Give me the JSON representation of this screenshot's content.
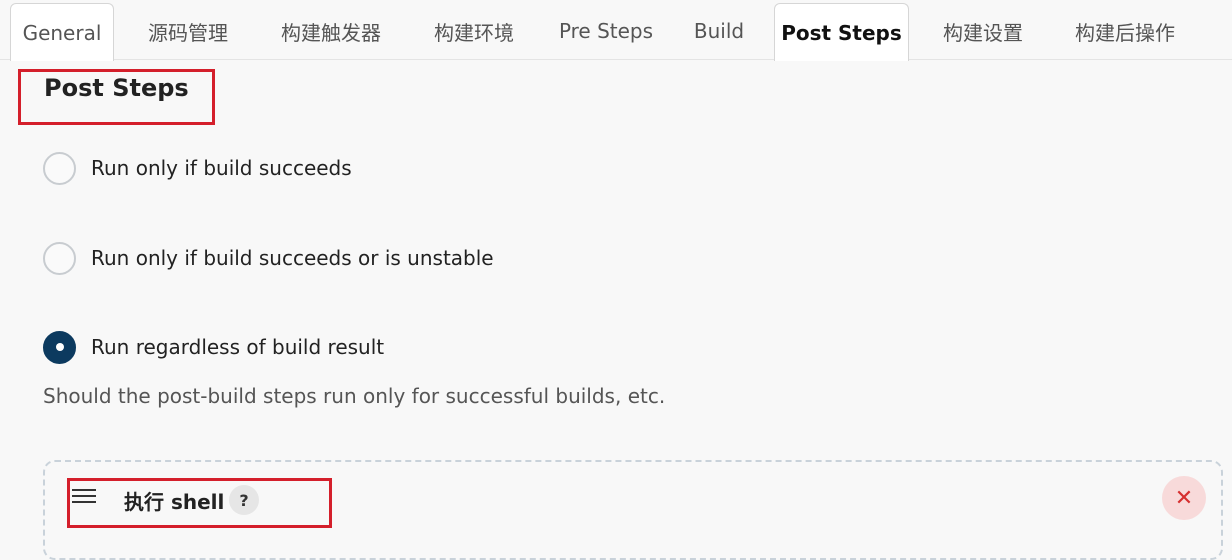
{
  "tabs": [
    {
      "label": "General"
    },
    {
      "label": "源码管理"
    },
    {
      "label": "构建触发器"
    },
    {
      "label": "构建环境"
    },
    {
      "label": "Pre Steps"
    },
    {
      "label": "Build"
    },
    {
      "label": "Post Steps",
      "active": true
    },
    {
      "label": "构建设置"
    },
    {
      "label": "构建后操作"
    }
  ],
  "section": {
    "title": "Post Steps",
    "options": [
      {
        "label": "Run only if build succeeds",
        "checked": false
      },
      {
        "label": "Run only if build succeeds or is unstable",
        "checked": false
      },
      {
        "label": "Run regardless of build result",
        "checked": true
      }
    ],
    "help_text": "Should the post-build steps run only for successful builds, etc."
  },
  "step": {
    "title": "执行 shell",
    "help_glyph": "?",
    "close_glyph": "✕"
  },
  "colors": {
    "accent": "#0c3a5f",
    "highlight_box": "#d41f2b",
    "close_bg": "#f8dada"
  },
  "icons": {
    "drag": "drag-handle-icon",
    "help": "help-icon",
    "close": "close-icon"
  }
}
